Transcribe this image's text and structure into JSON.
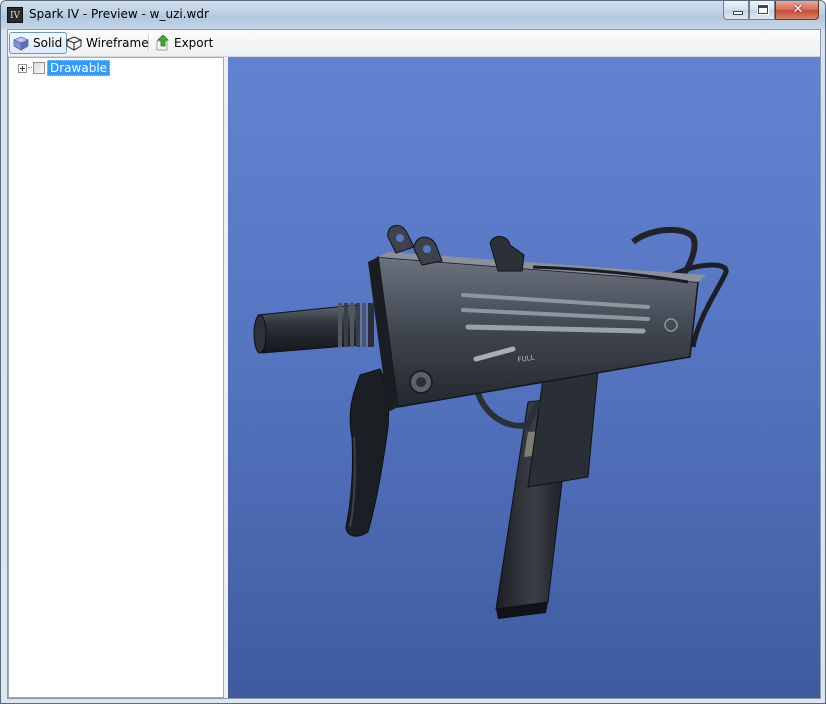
{
  "window": {
    "title": "Spark IV - Preview - w_uzi.wdr",
    "app_icon_text": "IV",
    "close_glyph": "✕"
  },
  "toolbar": {
    "solid_label": "Solid",
    "wireframe_label": "Wireframe",
    "export_label": "Export",
    "active_mode": "Solid"
  },
  "tree": {
    "nodes": [
      {
        "label": "Drawable",
        "expanded": false,
        "checked": false,
        "selected": true
      }
    ]
  },
  "viewport": {
    "model": "uzi-submachine-gun",
    "engraving_text": "FULL",
    "background_top": "#6383d2",
    "background_bottom": "#3f5b9e"
  },
  "colors": {
    "selection": "#3399ff",
    "gunmetal": "#3a3f47"
  }
}
